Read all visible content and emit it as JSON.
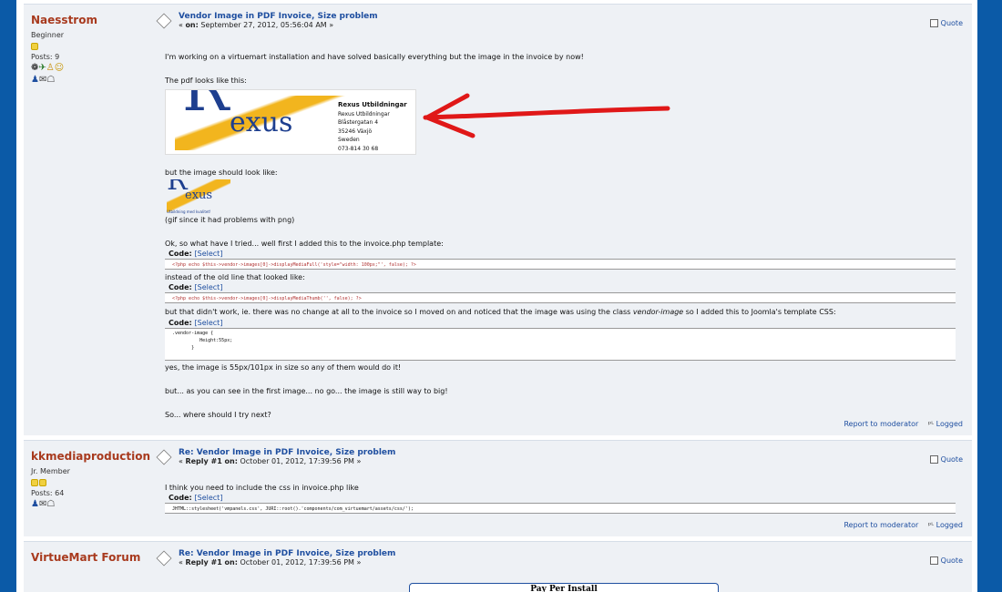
{
  "posts": [
    {
      "name": "Naesstrom",
      "rank": "Beginner",
      "posts": "Posts: 9",
      "title": "Vendor Image in PDF Invoice, Size problem",
      "meta_prefix": "« ",
      "meta_on": "on:",
      "meta_date": " September 27, 2012, 05:56:04 AM »",
      "quote": "Quote",
      "body": {
        "l1": "I'm working on a virtuemart installation and have solved basically everything but the image in the invoice by now!",
        "l2": "The pdf looks like this:",
        "rexus_name": "Rexus Utbildningar",
        "rexus_addr1": "Rexus Utbildningar",
        "rexus_addr2": "Blåstergatan 4",
        "rexus_addr3": "35246 Växjö",
        "rexus_addr4": "Sweden",
        "rexus_addr5": "073-814 30 68",
        "logo_R": "R",
        "logo_exus": "exus",
        "logo_tag": "Utbildning med kvalitet!",
        "l3": "but the image should look like:",
        "l4": "(gif since it had problems with png)",
        "l5": "Ok, so what have I tried... well first I added this to the invoice.php template:",
        "code_label": "Code:",
        "code_select": "[Select]",
        "code1": "<?php echo $this->vendor->images[0]->displayMediaFull('style=\"width: 100px;\"', false); ?>",
        "l6": "instead of the old line that looked like:",
        "code2": "<?php echo $this->vendor->images[0]->displayMediaThumb('', false); ?>",
        "l7a": "but that didn't work, ie. there was no change at all to the invoice so I moved on and noticed that the image was using the class ",
        "l7b": "vendor-image",
        "l7c": " so I added this to Joomla's template CSS:",
        "code3": ".vendor-image {\n          Height:55px;\n       }",
        "l8": "yes, the image is 55px/101px in size so any of them would do it!",
        "l9": "but... as you can see in the first image... no go... the image is still way to big!",
        "l10": "So... where should I try next?"
      },
      "report": "Report to moderator",
      "logged": "Logged"
    },
    {
      "name": "kkmediaproduction",
      "rank": "Jr. Member",
      "posts": "Posts: 64",
      "title": "Re: Vendor Image in PDF Invoice, Size problem",
      "meta_prefix": "« ",
      "meta_on": "Reply #1 on:",
      "meta_date": " October 01, 2012, 17:39:56 PM »",
      "quote": "Quote",
      "body": {
        "l1": "I think you need to include the css in invoice.php like",
        "code_label": "Code:",
        "code_select": "[Select]",
        "code1": "JHTML::stylesheet('vmpanels.css', JURI::root().'components/com_virtuemart/assets/css/');"
      },
      "report": "Report to moderator",
      "logged": "Logged"
    },
    {
      "name": "VirtueMart Forum",
      "title": "Re: Vendor Image in PDF Invoice, Size problem",
      "meta_prefix": "« ",
      "meta_on": "Reply #1 on:",
      "meta_date": " October 01, 2012, 17:39:56 PM »",
      "quote": "Quote",
      "banner": "Pay Per Install"
    }
  ],
  "colors": {
    "page_bg": "#0b5aa7",
    "post_bg": "#eef1f5",
    "name": "#a83a1e",
    "link": "#1f4fa0"
  },
  "icons": [
    "star-icon",
    "user-profile-icon",
    "email-icon",
    "pm-icon",
    "message-icon",
    "quote-icon",
    "logged-icon"
  ]
}
